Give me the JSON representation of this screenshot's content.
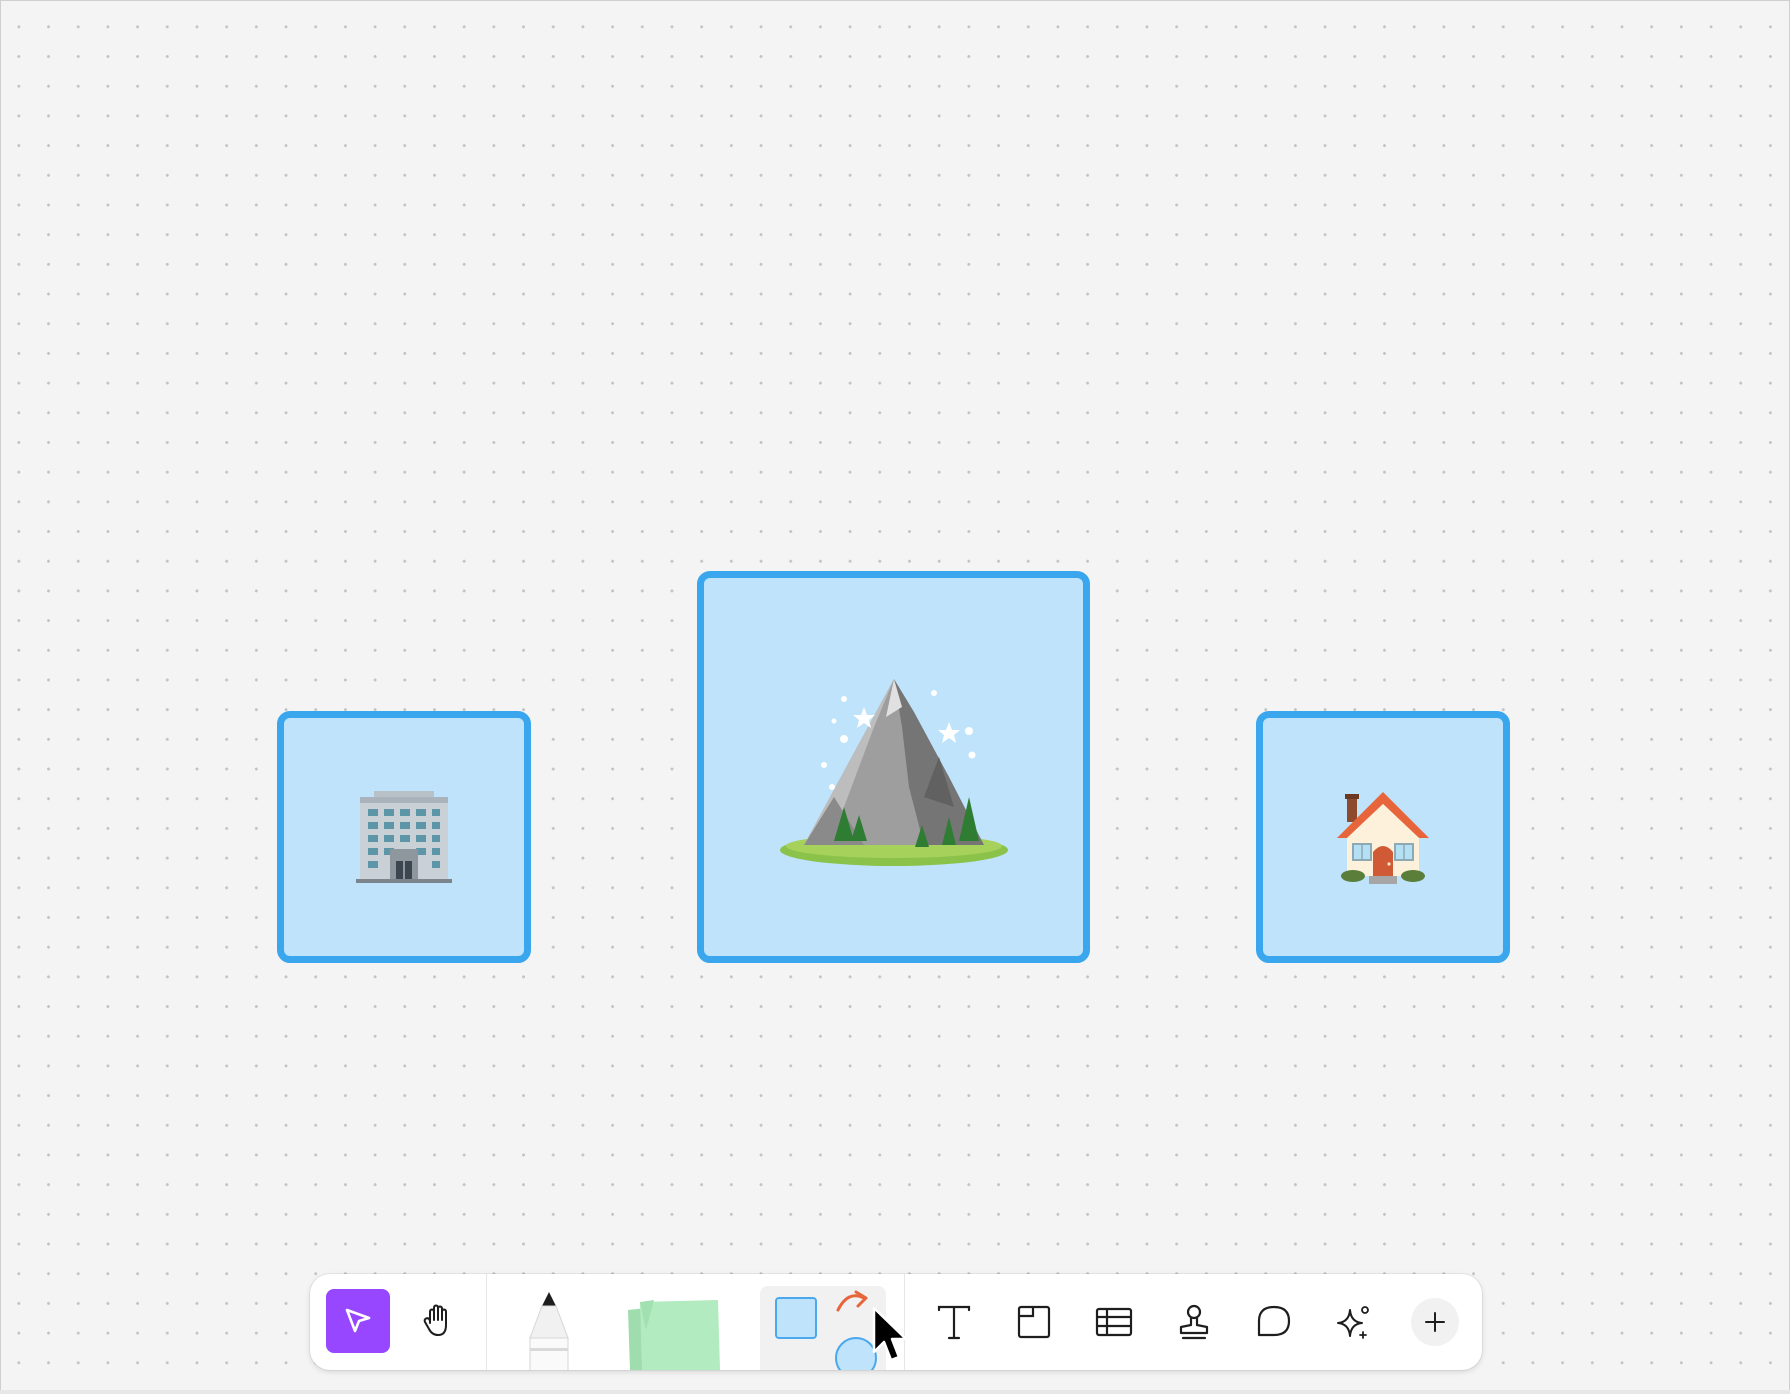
{
  "canvas": {
    "background": "#f4f4f4",
    "grid": "dots",
    "cards": [
      {
        "name": "building-card",
        "icon": "office-building-icon",
        "fill": "#bfe3fb",
        "border": "#3aa6ee"
      },
      {
        "name": "mountain-card",
        "icon": "snow-capped-mountain-icon",
        "fill": "#bfe3fb",
        "border": "#3aa6ee"
      },
      {
        "name": "house-card",
        "icon": "house-icon",
        "fill": "#bfe3fb",
        "border": "#3aa6ee"
      }
    ]
  },
  "toolbar": {
    "accent": "#9747ff",
    "tools": [
      {
        "id": "select",
        "icon": "move-arrow-icon",
        "active": true
      },
      {
        "id": "hand",
        "icon": "hand-icon",
        "active": false
      },
      {
        "id": "pen",
        "icon": "marker-pen-icon",
        "active": false
      },
      {
        "id": "sticky",
        "icon": "sticky-note-icon",
        "active": false
      },
      {
        "id": "shapes",
        "icon": "shapes-icon",
        "active": false
      },
      {
        "id": "text",
        "icon": "text-icon",
        "active": false
      },
      {
        "id": "section",
        "icon": "section-icon",
        "active": false
      },
      {
        "id": "table",
        "icon": "table-icon",
        "active": false
      },
      {
        "id": "stamp",
        "icon": "stamp-icon",
        "active": false
      },
      {
        "id": "comment",
        "icon": "comment-icon",
        "active": false
      },
      {
        "id": "ai",
        "icon": "sparkle-icon",
        "active": false
      },
      {
        "id": "more",
        "icon": "plus-icon",
        "active": false
      }
    ]
  }
}
